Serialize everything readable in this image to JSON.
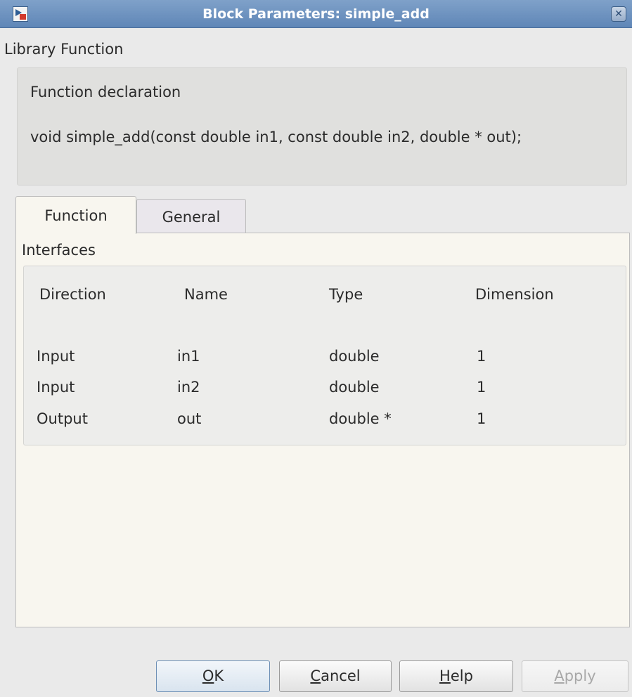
{
  "window": {
    "title": "Block Parameters: simple_add",
    "close_icon": "close-icon"
  },
  "library_label": "Library Function",
  "declaration": {
    "title": "Function declaration",
    "text": "void simple_add(const double in1, const double in2, double * out);"
  },
  "tabs": [
    {
      "label": "Function",
      "active": true
    },
    {
      "label": "General",
      "active": false
    }
  ],
  "interfaces": {
    "label": "Interfaces",
    "columns": [
      "Direction",
      "Name",
      "Type",
      "Dimension"
    ],
    "rows": [
      [
        "Input",
        "in1",
        "double",
        "1"
      ],
      [
        "Input",
        "in2",
        "double",
        "1"
      ],
      [
        "Output",
        "out",
        "double *",
        "1"
      ]
    ]
  },
  "buttons": {
    "ok": {
      "mnemonic": "O",
      "rest": "K"
    },
    "cancel": {
      "mnemonic": "C",
      "rest": "ancel"
    },
    "help": {
      "mnemonic": "H",
      "rest": "elp"
    },
    "apply": {
      "mnemonic": "A",
      "rest": "pply",
      "disabled": true
    }
  }
}
